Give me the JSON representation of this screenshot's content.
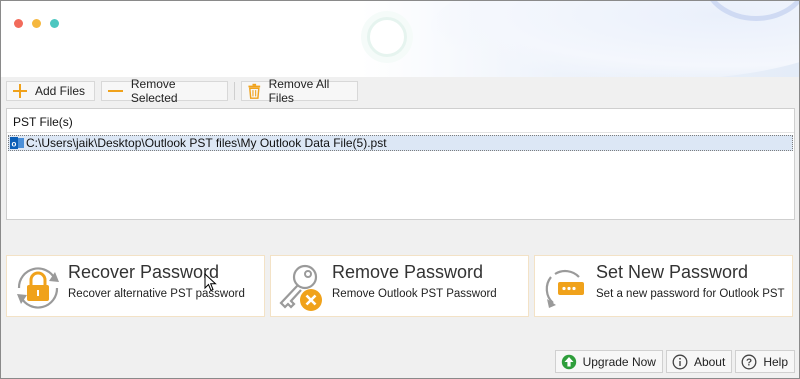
{
  "toolbar": {
    "add_files": "Add Files",
    "remove_selected": "Remove Selected",
    "remove_all": "Remove All Files"
  },
  "file_list": {
    "column_header": "PST File(s)",
    "rows": [
      {
        "path": "C:\\Users\\jaik\\Desktop\\Outlook PST files\\My Outlook Data File(5).pst",
        "selected": true
      }
    ]
  },
  "actions": [
    {
      "title": "Recover Password",
      "subtitle": "Recover alternative PST password",
      "icon": "recover-lock-icon"
    },
    {
      "title": "Remove Password",
      "subtitle": "Remove Outlook PST Password",
      "icon": "remove-key-icon"
    },
    {
      "title": "Set New Password",
      "subtitle": "Set a new password for Outlook PST",
      "icon": "set-password-icon"
    }
  ],
  "footer": {
    "upgrade": "Upgrade Now",
    "about": "About",
    "help": "Help"
  },
  "colors": {
    "accent": "#f0a21b",
    "selection": "#dce7f5",
    "upgrade_green": "#2e9e3b"
  }
}
